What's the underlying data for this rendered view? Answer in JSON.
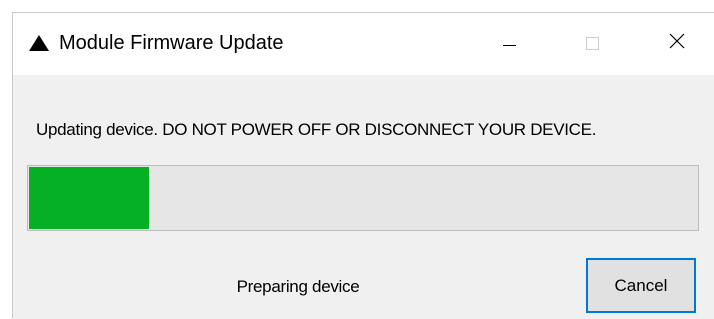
{
  "window": {
    "title": "Module Firmware Update",
    "app_icon": "triangle-icon",
    "controls": {
      "minimize": "minimize-icon",
      "maximize": "maximize-icon",
      "close": "close-icon"
    }
  },
  "message": "Updating device. DO NOT POWER OFF OR DISCONNECT YOUR DEVICE.",
  "progress": {
    "fraction": 0.18,
    "fill_color": "#06b025",
    "track_color": "#e6e6e6"
  },
  "status_text": "Preparing device",
  "cancel_label": "Cancel",
  "colors": {
    "focus_border": "#0078d7",
    "client_background": "#f0f0f0"
  }
}
